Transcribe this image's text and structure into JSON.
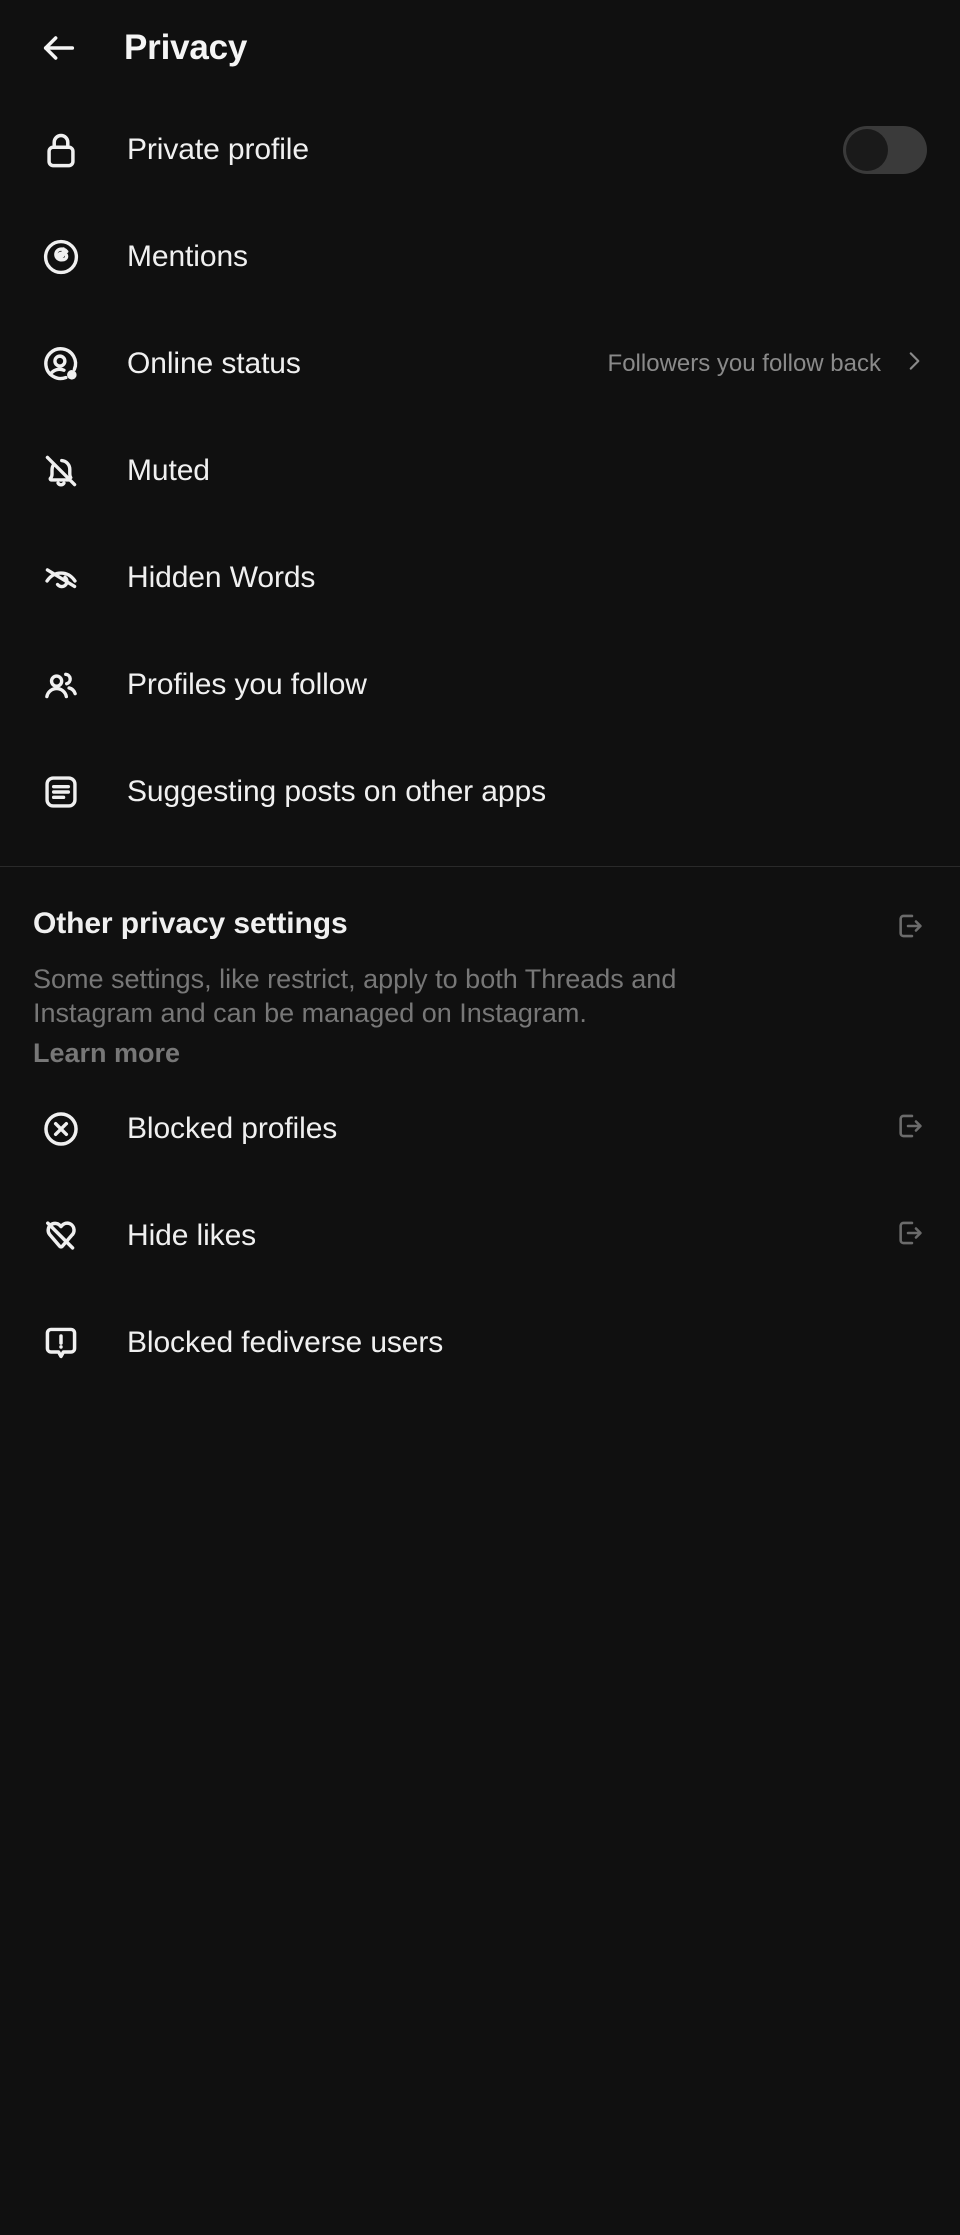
{
  "header": {
    "back_icon": "arrow-left-icon",
    "title": "Privacy"
  },
  "settings_list": [
    {
      "id": "private-profile",
      "icon": "lock-icon",
      "label": "Private profile",
      "control": "toggle",
      "toggle_on": false
    },
    {
      "id": "mentions",
      "icon": "threads-logo-icon",
      "label": "Mentions",
      "control": "none"
    },
    {
      "id": "online-status",
      "icon": "avatar-status-icon",
      "label": "Online status",
      "control": "chevron",
      "value": "Followers you follow back"
    },
    {
      "id": "muted",
      "icon": "bell-slash-icon",
      "label": "Muted",
      "control": "none"
    },
    {
      "id": "hidden-words",
      "icon": "eye-slash-icon",
      "label": "Hidden Words",
      "control": "none"
    },
    {
      "id": "profiles-you-follow",
      "icon": "people-icon",
      "label": "Profiles you follow",
      "control": "none"
    },
    {
      "id": "suggesting-posts",
      "icon": "feed-list-icon",
      "label": "Suggesting posts on other apps",
      "control": "none"
    }
  ],
  "other_privacy": {
    "title": "Other privacy settings",
    "description": "Some settings, like restrict, apply to both Threads and Instagram and can be managed on Instagram.",
    "learn_more_label": "Learn more",
    "external_icon": "external-link-icon"
  },
  "other_list": [
    {
      "id": "blocked-profiles",
      "icon": "circle-x-icon",
      "label": "Blocked profiles",
      "control": "external"
    },
    {
      "id": "hide-likes",
      "icon": "heart-slash-icon",
      "label": "Hide likes",
      "control": "external"
    },
    {
      "id": "blocked-fediverse-users",
      "icon": "bubble-exclamation-icon",
      "label": "Blocked fediverse users",
      "control": "none"
    }
  ],
  "colors": {
    "background": "#101010",
    "text_primary": "#f0f0f0",
    "text_secondary": "#777777",
    "divider": "#2a2a2a",
    "toggle_track": "#3a3a3a",
    "toggle_knob": "#1a1a1a"
  }
}
